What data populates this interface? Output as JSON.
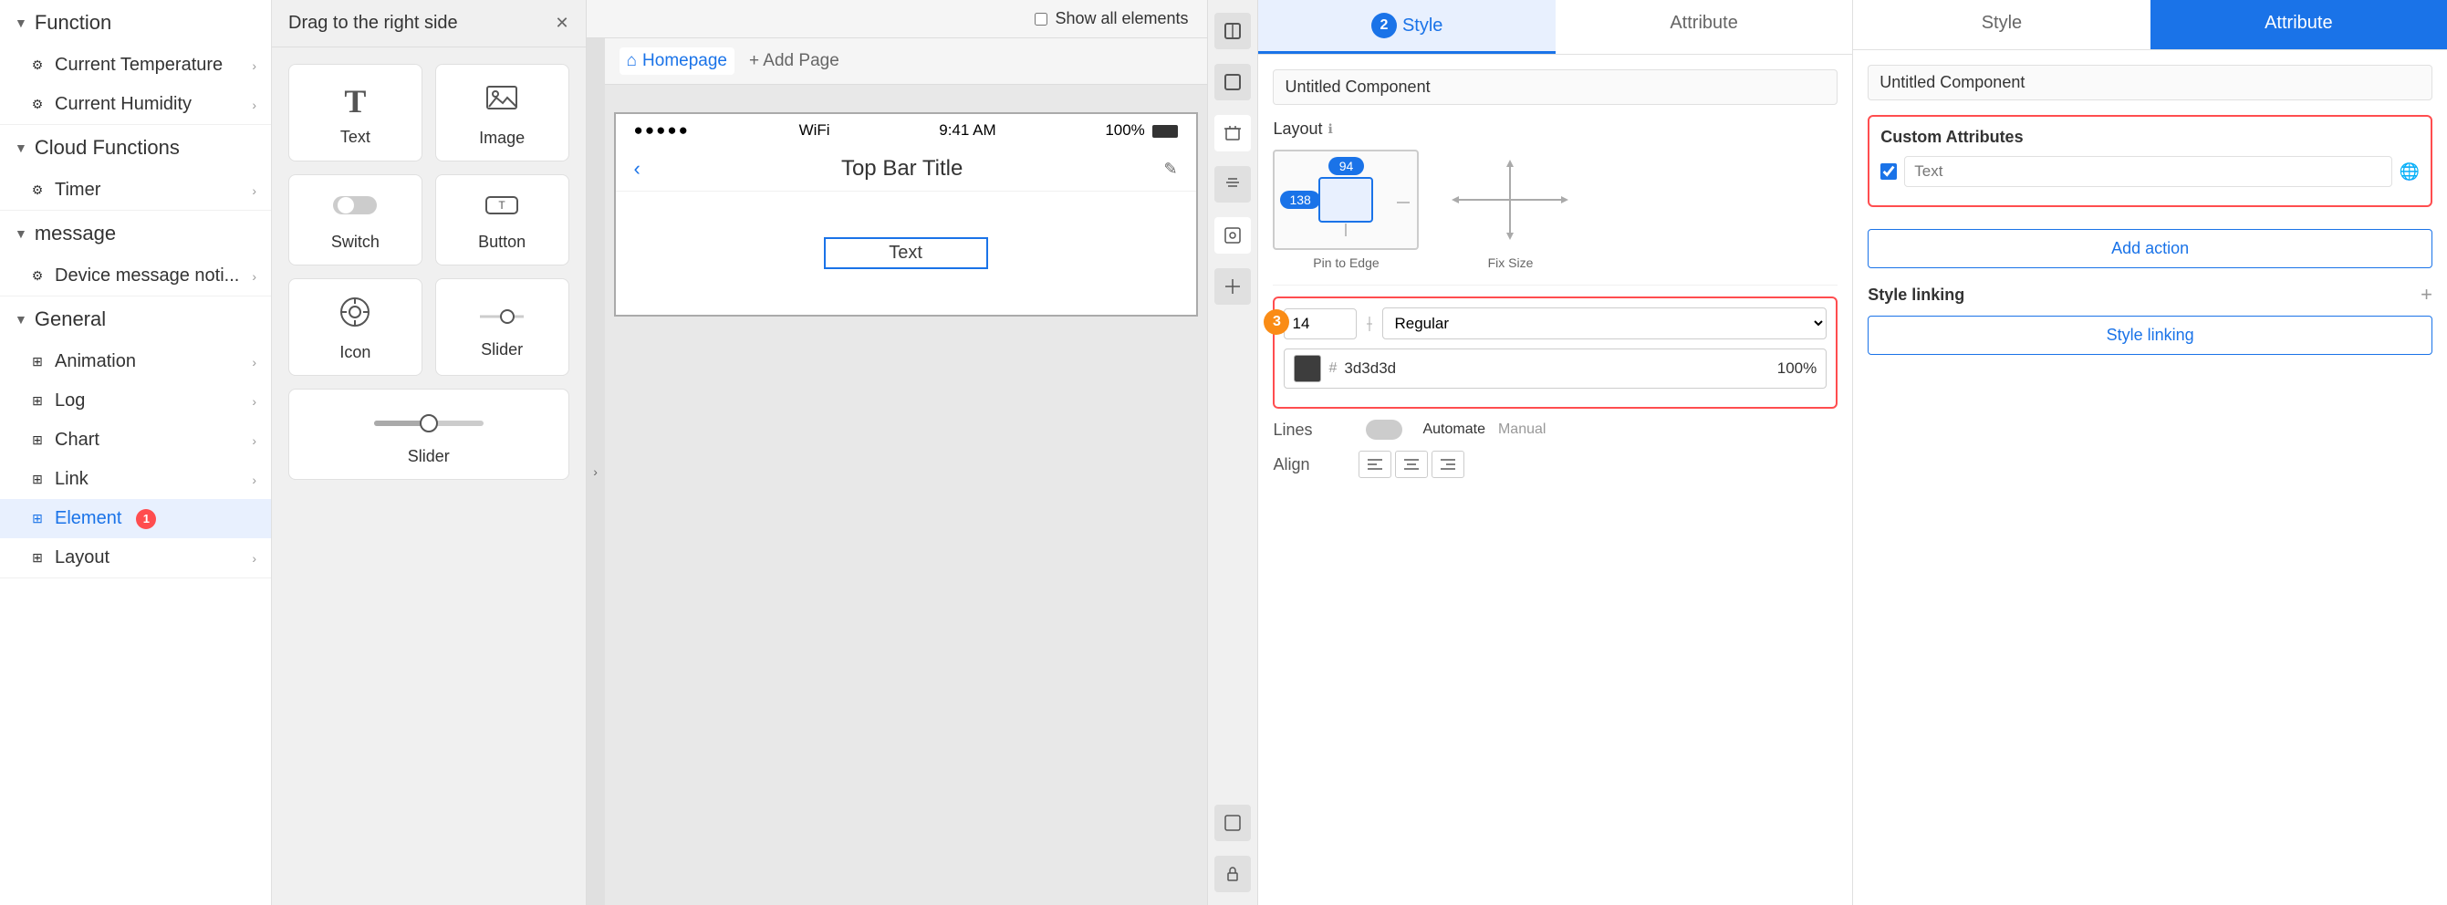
{
  "sidebar": {
    "sections": [
      {
        "id": "function",
        "label": "Function",
        "expanded": true,
        "items": [
          {
            "id": "current-temperature",
            "label": "Current Temperature",
            "icon": "⚙"
          },
          {
            "id": "current-humidity",
            "label": "Current Humidity",
            "icon": "⚙"
          }
        ]
      },
      {
        "id": "cloud-functions",
        "label": "Cloud Functions",
        "expanded": true,
        "items": [
          {
            "id": "timer",
            "label": "Timer",
            "icon": "⚙"
          }
        ]
      },
      {
        "id": "message",
        "label": "message",
        "expanded": true,
        "items": [
          {
            "id": "device-message",
            "label": "Device message noti...",
            "icon": "⚙"
          }
        ]
      },
      {
        "id": "general",
        "label": "General",
        "expanded": true,
        "items": [
          {
            "id": "animation",
            "label": "Animation",
            "icon": "⊞"
          },
          {
            "id": "log",
            "label": "Log",
            "icon": "⊞"
          },
          {
            "id": "chart",
            "label": "Chart",
            "icon": "⊞"
          },
          {
            "id": "link",
            "label": "Link",
            "icon": "⊞"
          },
          {
            "id": "element",
            "label": "Element",
            "icon": "⊞",
            "active": true,
            "badge": "1"
          },
          {
            "id": "layout",
            "label": "Layout",
            "icon": "⊞"
          }
        ]
      }
    ]
  },
  "component_panel": {
    "header": "Drag to the right side",
    "components": [
      {
        "id": "text",
        "label": "Text",
        "icon": "T"
      },
      {
        "id": "image",
        "label": "Image",
        "icon": "🖼"
      },
      {
        "id": "switch",
        "label": "Switch",
        "icon": "⊙"
      },
      {
        "id": "button",
        "label": "Button",
        "icon": "T"
      },
      {
        "id": "icon",
        "label": "Icon",
        "icon": "⚙"
      },
      {
        "id": "slider",
        "label": "Slider",
        "icon": "⊸"
      },
      {
        "id": "slider2",
        "label": "Slider",
        "icon": "⊸",
        "wide": true
      }
    ]
  },
  "canvas": {
    "show_all_label": "Show all elements",
    "page_tab_label": "Homepage",
    "add_page_label": "+ Add Page",
    "phone": {
      "time": "9:41 AM",
      "signal": "●●●●●",
      "wifi": "WiFi",
      "battery": "100%",
      "title": "Top Bar Title",
      "content_text": "Text"
    }
  },
  "right_panel": {
    "left_col": {
      "tabs": [
        "Style",
        "Attribute"
      ],
      "active_tab": "Style",
      "badge": "2",
      "component_name": "Untitled Component",
      "layout_section": {
        "label": "Layout",
        "pin_label": "Pin to Edge",
        "fix_label": "Fix Size",
        "value_138": "138",
        "value_94": "94"
      },
      "font_section": {
        "size": "14",
        "style": "Regular",
        "color_hex": "3d3d3d",
        "opacity": "100%",
        "badge": "3"
      },
      "lines_section": {
        "label": "Lines",
        "automate_label": "Automate",
        "manual_label": "Manual"
      },
      "align_section": {
        "label": "Align",
        "options": [
          "left",
          "center",
          "right"
        ]
      }
    },
    "right_col": {
      "tabs": [
        "Style",
        "Attribute"
      ],
      "active_tab": "Attribute",
      "component_name": "Untitled Component",
      "custom_attrs": {
        "header": "Custom Attributes",
        "input_placeholder": "Text",
        "checkbox_checked": true
      },
      "add_action_label": "Add action",
      "style_linking": {
        "label": "Style linking",
        "button_label": "Style linking"
      }
    }
  }
}
